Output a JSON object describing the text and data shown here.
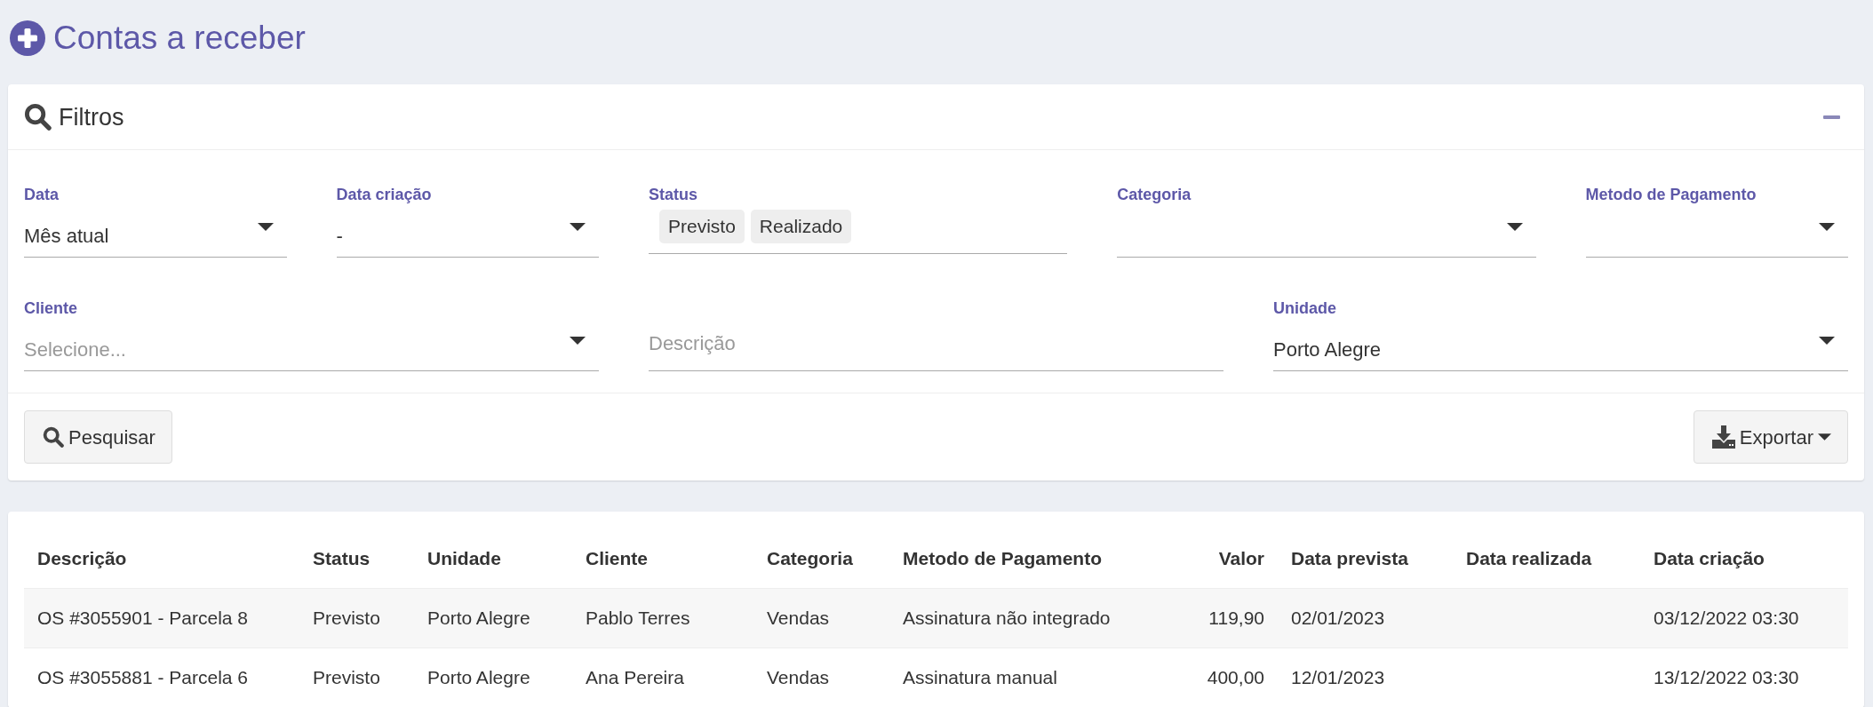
{
  "page": {
    "title": "Contas a receber"
  },
  "filters": {
    "title": "Filtros",
    "fields": [
      {
        "kind": "select",
        "label": "Data",
        "value": "Mês atual"
      },
      {
        "kind": "select",
        "label": "Data criação",
        "value": "-"
      },
      {
        "kind": "tags",
        "label": "Status",
        "tags": [
          "Previsto",
          "Realizado"
        ]
      },
      {
        "kind": "select",
        "label": "Categoria"
      },
      {
        "kind": "select",
        "label": "Metodo de Pagamento"
      },
      {
        "kind": "select",
        "label": "Cliente",
        "placeholder": "Selecione..."
      },
      {
        "kind": "text",
        "placeholder": "Descrição"
      },
      {
        "kind": "select",
        "label": "Unidade",
        "value": "Porto Alegre"
      }
    ],
    "actions": [
      {
        "kind": "search",
        "label": "Pesquisar"
      },
      {
        "kind": "export",
        "label": "Exportar"
      }
    ]
  },
  "table": {
    "columns": [
      {
        "label": "Descrição",
        "kind": "text"
      },
      {
        "label": "Status",
        "kind": "text"
      },
      {
        "label": "Unidade",
        "kind": "text"
      },
      {
        "label": "Cliente",
        "kind": "text"
      },
      {
        "label": "Categoria",
        "kind": "text"
      },
      {
        "label": "Metodo de Pagamento",
        "kind": "text"
      },
      {
        "label": "Valor",
        "kind": "number"
      },
      {
        "label": "Data prevista",
        "kind": "text"
      },
      {
        "label": "Data realizada",
        "kind": "text"
      },
      {
        "label": "Data criação",
        "kind": "text"
      }
    ],
    "rows": [
      [
        "OS #3055901 - Parcela 8",
        "Previsto",
        "Porto Alegre",
        "Pablo Terres",
        "Vendas",
        "Assinatura não integrado",
        "119,90",
        "02/01/2023",
        null,
        "03/12/2022 03:30"
      ],
      [
        "OS #3055881 - Parcela 6",
        "Previsto",
        "Porto Alegre",
        "Ana Pereira",
        "Vendas",
        "Assinatura manual",
        "400,00",
        "12/01/2023",
        null,
        "13/12/2022 03:30"
      ]
    ]
  }
}
